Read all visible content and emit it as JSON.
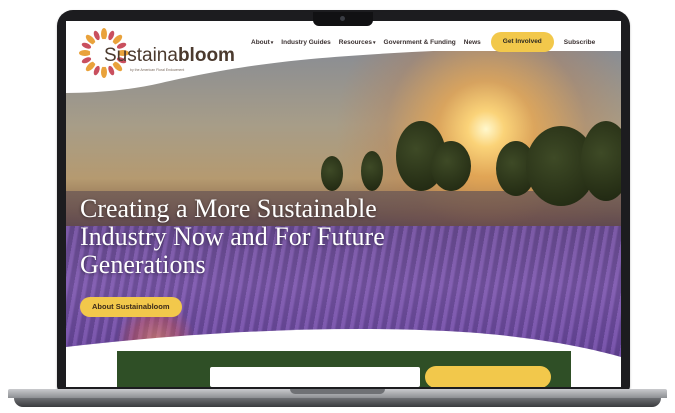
{
  "logo": {
    "name_regular": "Sustaina",
    "name_bold": "bloom",
    "tagline": "by the American Floral Endowment"
  },
  "nav": {
    "items": [
      {
        "label": "About",
        "dropdown": true
      },
      {
        "label": "Industry Guides",
        "dropdown": false
      },
      {
        "label": "Resources",
        "dropdown": true
      },
      {
        "label": "Government & Funding",
        "dropdown": false
      },
      {
        "label": "News",
        "dropdown": false
      }
    ],
    "cta_label": "Get Involved",
    "subscribe_label": "Subscribe"
  },
  "hero": {
    "title": "Creating a More Sustainable Industry Now and For Future Generations",
    "button_label": "About Sustainabloom"
  },
  "colors": {
    "accent_yellow": "#f2c84b",
    "brand_green": "#2f4f26",
    "text_dark": "#3a3030",
    "laptop_bezel": "#1c1c1f"
  }
}
